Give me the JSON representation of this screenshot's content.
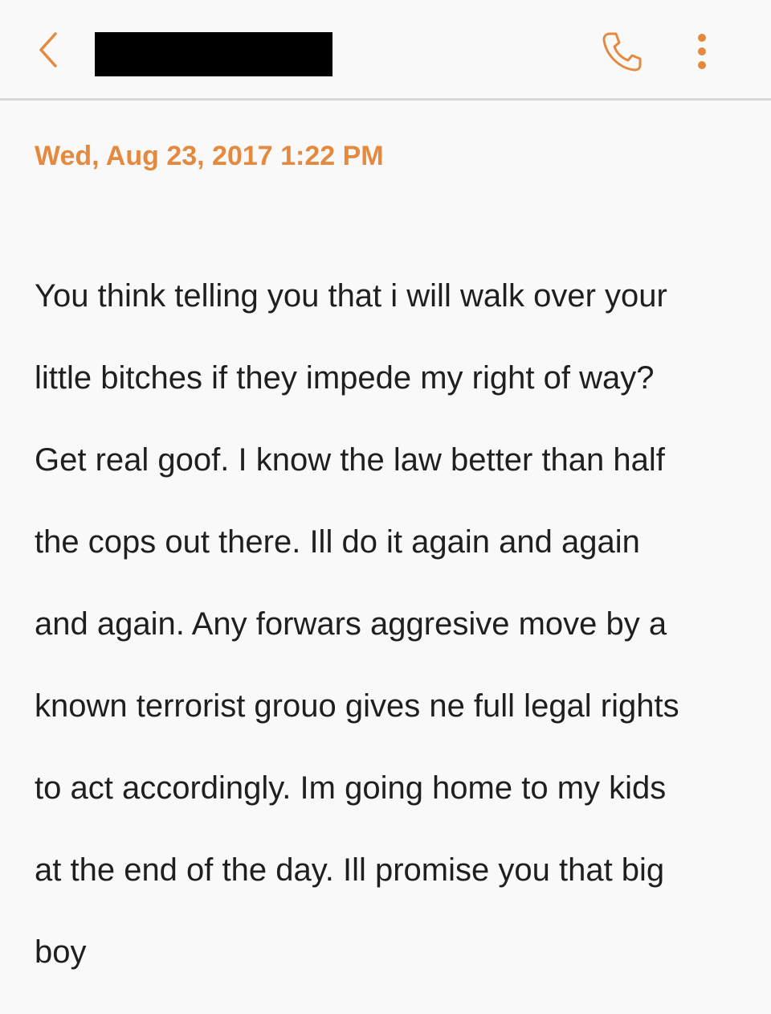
{
  "app_bar": {
    "back_icon": "chevron-left-icon",
    "contact_name": "",
    "contact_redacted": true,
    "call_icon": "phone-icon",
    "more_icon": "more-vertical-icon"
  },
  "message": {
    "timestamp": "Wed, Aug 23, 2017 1:22 PM",
    "lines": [
      "You think telling you that i will walk over your",
      "little bitches if they impede my right of way?",
      "Get real goof. I know the law better than half",
      "the cops out there. Ill do it again and again",
      "and again. Any forwars aggresive move by a",
      "known terrorist grouo gives ne full legal rights",
      "to act accordingly. Im going home to my kids",
      "at the end of the day. Ill promise you that big",
      "boy"
    ]
  },
  "colors": {
    "accent": "#e4893e",
    "background": "#f9f9f9",
    "text": "#1f1f1f",
    "divider": "#d8d8d8",
    "redaction": "#000000"
  }
}
